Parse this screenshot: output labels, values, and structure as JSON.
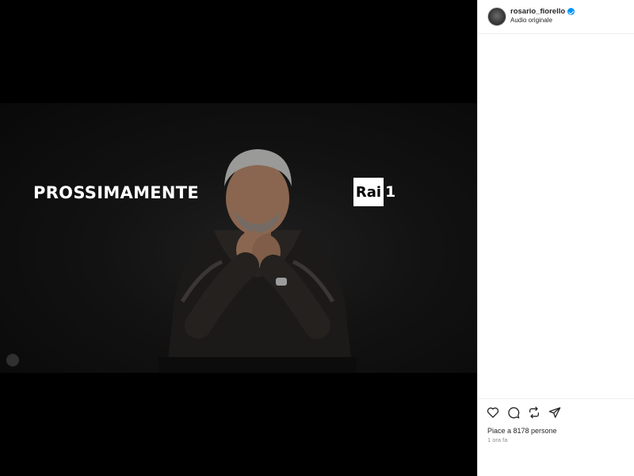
{
  "post": {
    "overlay_text": "PROSSIMAMENTE",
    "logo_text": "Rai",
    "logo_number": "1"
  },
  "header": {
    "username": "rosario_fiorello",
    "subtitle": "Audio originale"
  },
  "footer": {
    "likes": "Piace a 8178 persone",
    "time": "1 ora fa"
  },
  "icons": [
    "heart-icon",
    "comment-icon",
    "repost-icon",
    "share-icon"
  ],
  "colors": {
    "verified": "#0095f6",
    "background": "#000000",
    "text": "#262626"
  }
}
